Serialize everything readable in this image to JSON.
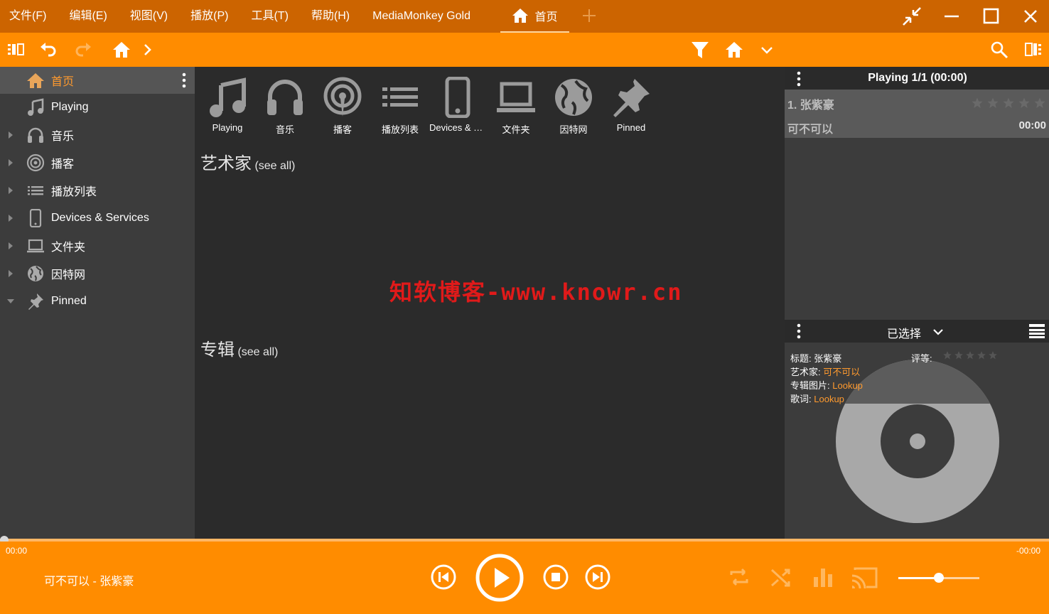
{
  "menu": [
    "文件(F)",
    "编辑(E)",
    "视图(V)",
    "播放(P)",
    "工具(T)",
    "帮助(H)"
  ],
  "app_title": "MediaMonkey Gold",
  "tab": {
    "label": "首页"
  },
  "sidebar": {
    "items": [
      {
        "label": "首页",
        "icon": "home-icon",
        "active": true
      },
      {
        "label": "Playing",
        "icon": "music-note-icon"
      },
      {
        "label": "音乐",
        "icon": "headphones-icon"
      },
      {
        "label": "播客",
        "icon": "podcast-icon"
      },
      {
        "label": "播放列表",
        "icon": "list-icon"
      },
      {
        "label": "Devices & Services",
        "icon": "phone-icon"
      },
      {
        "label": "文件夹",
        "icon": "laptop-icon"
      },
      {
        "label": "因特网",
        "icon": "globe-icon"
      },
      {
        "label": "Pinned",
        "icon": "pin-icon"
      }
    ]
  },
  "main": {
    "tiles": [
      {
        "label": "Playing",
        "icon": "music-note-icon"
      },
      {
        "label": "音乐",
        "icon": "headphones-icon"
      },
      {
        "label": "播客",
        "icon": "podcast-icon"
      },
      {
        "label": "播放列表",
        "icon": "list-icon"
      },
      {
        "label": "Devices & S...",
        "icon": "phone-icon"
      },
      {
        "label": "文件夹",
        "icon": "laptop-icon"
      },
      {
        "label": "因特网",
        "icon": "globe-icon"
      },
      {
        "label": "Pinned",
        "icon": "pin-icon"
      }
    ],
    "artists": {
      "title": "艺术家",
      "see_all": "(see all)"
    },
    "albums": {
      "title": "专辑",
      "see_all": "(see all)"
    },
    "watermark": "知软博客-www.knowr.cn"
  },
  "now_playing": {
    "title": "Playing 1/1 (00:00)",
    "track": {
      "index": "1.",
      "title": "张紫豪",
      "artist": "可不可以",
      "duration": "00:00",
      "rating": 0
    }
  },
  "selection": {
    "title": "已选择",
    "fields": {
      "title_label": "标题:",
      "title_value": "张紫豪",
      "rating_label": "评等:",
      "artist_label": "艺术家:",
      "artist_value": "可不可以",
      "art_label": "专辑图片:",
      "art_value": "Lookup",
      "lyrics_label": "歌词:",
      "lyrics_value": "Lookup"
    }
  },
  "player": {
    "elapsed": "00:00",
    "remaining": "-00:00",
    "now_playing": "可不可以 - 张紫豪",
    "progress": 0,
    "volume": 0.5
  },
  "colors": {
    "accent": "#ff8c00",
    "titlebar": "#cc6400",
    "link": "#ff9a2e"
  }
}
